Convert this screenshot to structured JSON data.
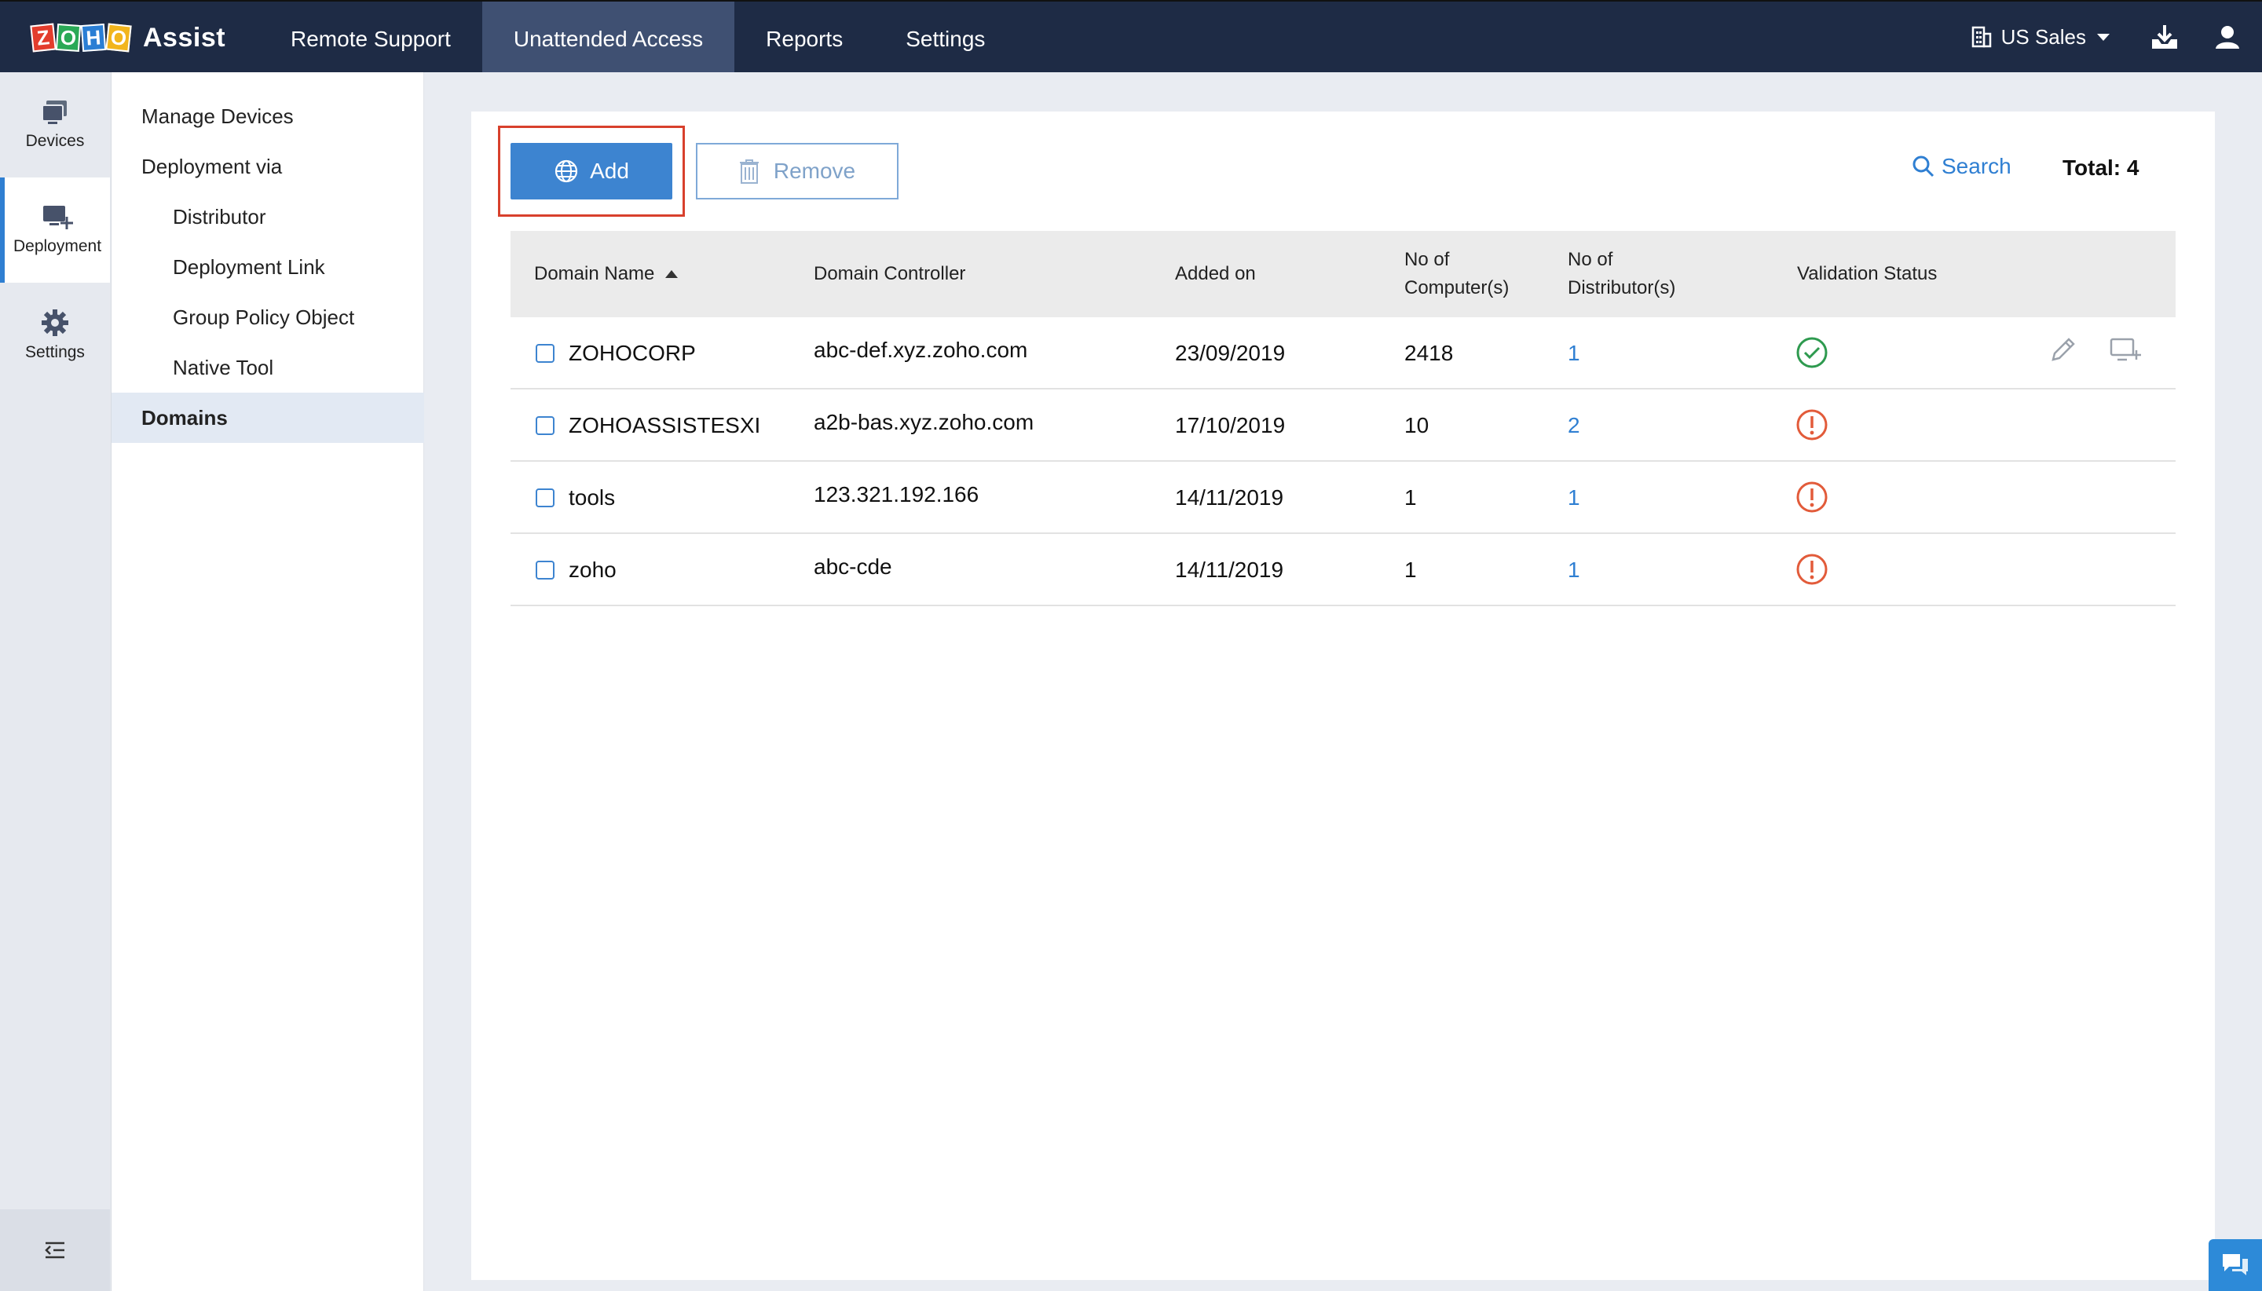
{
  "app": {
    "brand_letters": [
      "Z",
      "O",
      "H",
      "O"
    ],
    "brand_name": "Assist"
  },
  "topnav": {
    "items": [
      {
        "label": "Remote Support"
      },
      {
        "label": "Unattended Access",
        "active": true
      },
      {
        "label": "Reports"
      },
      {
        "label": "Settings"
      }
    ],
    "org_label": "US Sales",
    "icons": [
      "building-icon",
      "download-icon",
      "user-icon"
    ]
  },
  "rail": {
    "items": [
      {
        "label": "Devices",
        "icon": "devices-icon"
      },
      {
        "label": "Deployment",
        "icon": "deployment-icon",
        "active": true
      },
      {
        "label": "Settings",
        "icon": "gear-icon"
      }
    ],
    "collapse_icon": "collapse-menu-icon"
  },
  "subnav": {
    "items": [
      {
        "label": "Manage Devices",
        "level": 1
      },
      {
        "label": "Deployment via",
        "level": 1
      },
      {
        "label": "Distributor",
        "level": 2
      },
      {
        "label": "Deployment Link",
        "level": 2
      },
      {
        "label": "Group Policy Object",
        "level": 2
      },
      {
        "label": "Native Tool",
        "level": 2
      },
      {
        "label": "Domains",
        "level": 1,
        "active": true
      }
    ]
  },
  "toolbar": {
    "add_label": "Add",
    "remove_label": "Remove",
    "search_label": "Search",
    "total_label": "Total: 4"
  },
  "table": {
    "columns": [
      {
        "label": "Domain Name",
        "sorted": "asc"
      },
      {
        "label": "Domain Controller"
      },
      {
        "label": "Added on"
      },
      {
        "label": "No of\nComputer(s)"
      },
      {
        "label": "No of\nDistributor(s)"
      },
      {
        "label": "Validation Status"
      }
    ],
    "rows": [
      {
        "domain": "ZOHOCORP",
        "controller": "abc-def.xyz.zoho.com",
        "added": "23/09/2019",
        "computers": "2418",
        "distributors": "1",
        "status": "valid",
        "actions": [
          "edit-icon",
          "add-computer-icon"
        ]
      },
      {
        "domain": "ZOHOASSISTESXI",
        "controller": "a2b-bas.xyz.zoho.com",
        "added": "17/10/2019",
        "computers": "10",
        "distributors": "2",
        "status": "warning"
      },
      {
        "domain": "tools",
        "controller": "123.321.192.166",
        "added": "14/11/2019",
        "computers": "1",
        "distributors": "1",
        "status": "warning"
      },
      {
        "domain": "zoho",
        "controller": "abc-cde",
        "added": "14/11/2019",
        "computers": "1",
        "distributors": "1",
        "status": "warning"
      }
    ]
  },
  "colors": {
    "topbar": "#1e2b45",
    "topbar_active": "#3f5072",
    "accent": "#2f7fd2",
    "status_ok": "#2e9a4f",
    "status_warn": "#e25b3a",
    "highlight_outline": "#d8402c"
  },
  "chat_icon": "chat-icon"
}
